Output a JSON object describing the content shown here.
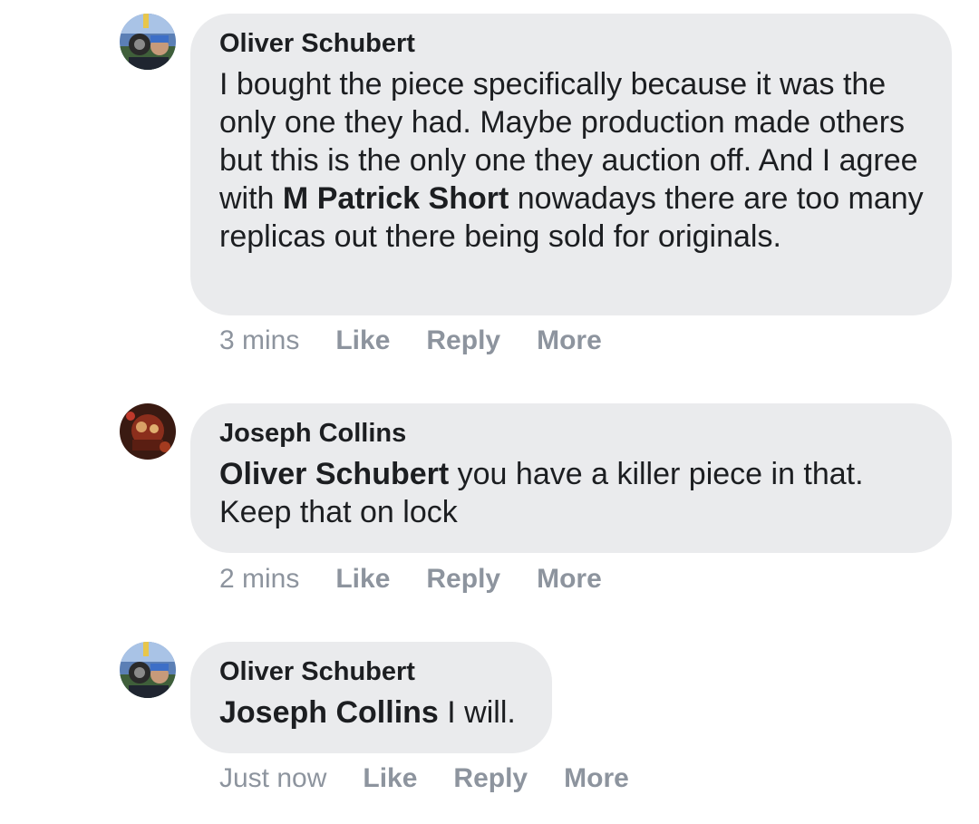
{
  "comments": [
    {
      "author": "Oliver Schubert",
      "avatar_icon": "person-photo-icon",
      "mention": "",
      "text_before": "I bought the piece specifically because it was the only one they had. Maybe production made others but this is the only one they auction off. And I agree with ",
      "inline_mention": "M Patrick Short",
      "text_after": " nowadays there are too many replicas out there being sold for originals.",
      "time": "3 mins",
      "like": "Like",
      "reply": "Reply",
      "more": "More"
    },
    {
      "author": "Joseph Collins",
      "avatar_icon": "person-photo-icon",
      "mention": "Oliver Schubert",
      "text": " you have a killer piece in that. Keep that on lock",
      "time": "2 mins",
      "like": "Like",
      "reply": "Reply",
      "more": "More"
    },
    {
      "author": "Oliver Schubert",
      "avatar_icon": "person-photo-icon",
      "mention": "Joseph Collins",
      "text": " I will.",
      "time": "Just now",
      "like": "Like",
      "reply": "Reply",
      "more": "More"
    }
  ],
  "colors": {
    "bubble": "#eaebed",
    "text": "#1c1e21",
    "meta": "#8d949e"
  }
}
